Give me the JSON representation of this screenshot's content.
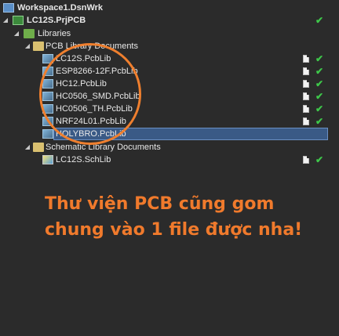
{
  "tree": {
    "workspace": {
      "label": "Workspace1.DsnWrk",
      "icon": "workspace-icon"
    },
    "project": {
      "label": "LC12S.PrjPCB",
      "icon": "pcb-project-icon",
      "status": "ok"
    },
    "libraries_folder": {
      "label": "Libraries",
      "icon": "folder-icon"
    },
    "pcb_lib_folder": {
      "label": "PCB Library Documents",
      "icon": "folder-icon"
    },
    "pcb_libs": [
      {
        "label": "LC12S.PcbLib",
        "icon": "pcblib-icon"
      },
      {
        "label": "ESP8266-12F.PcbLib",
        "icon": "pcblib-icon"
      },
      {
        "label": "HC12.PcbLib",
        "icon": "pcblib-icon"
      },
      {
        "label": "HC0506_SMD.PcbLib",
        "icon": "pcblib-icon"
      },
      {
        "label": "HC0506_TH.PcbLib",
        "icon": "pcblib-icon"
      },
      {
        "label": "NRF24L01.PcbLib",
        "icon": "pcblib-icon"
      },
      {
        "label": "HOLYBRO.PcbLib",
        "icon": "pcblib-icon",
        "selected": true
      }
    ],
    "sch_lib_folder": {
      "label": "Schematic Library Documents",
      "icon": "folder-icon"
    },
    "sch_libs": [
      {
        "label": "LC12S.SchLib",
        "icon": "schlib-icon"
      }
    ]
  },
  "status_icons": {
    "document": "document-icon",
    "check": "check-icon",
    "check_color": "#3ec84a"
  },
  "annotation": {
    "caption": "Thư viện PCB cũng gom chung vào 1 file được nha!",
    "color": "#ef7f2e"
  }
}
